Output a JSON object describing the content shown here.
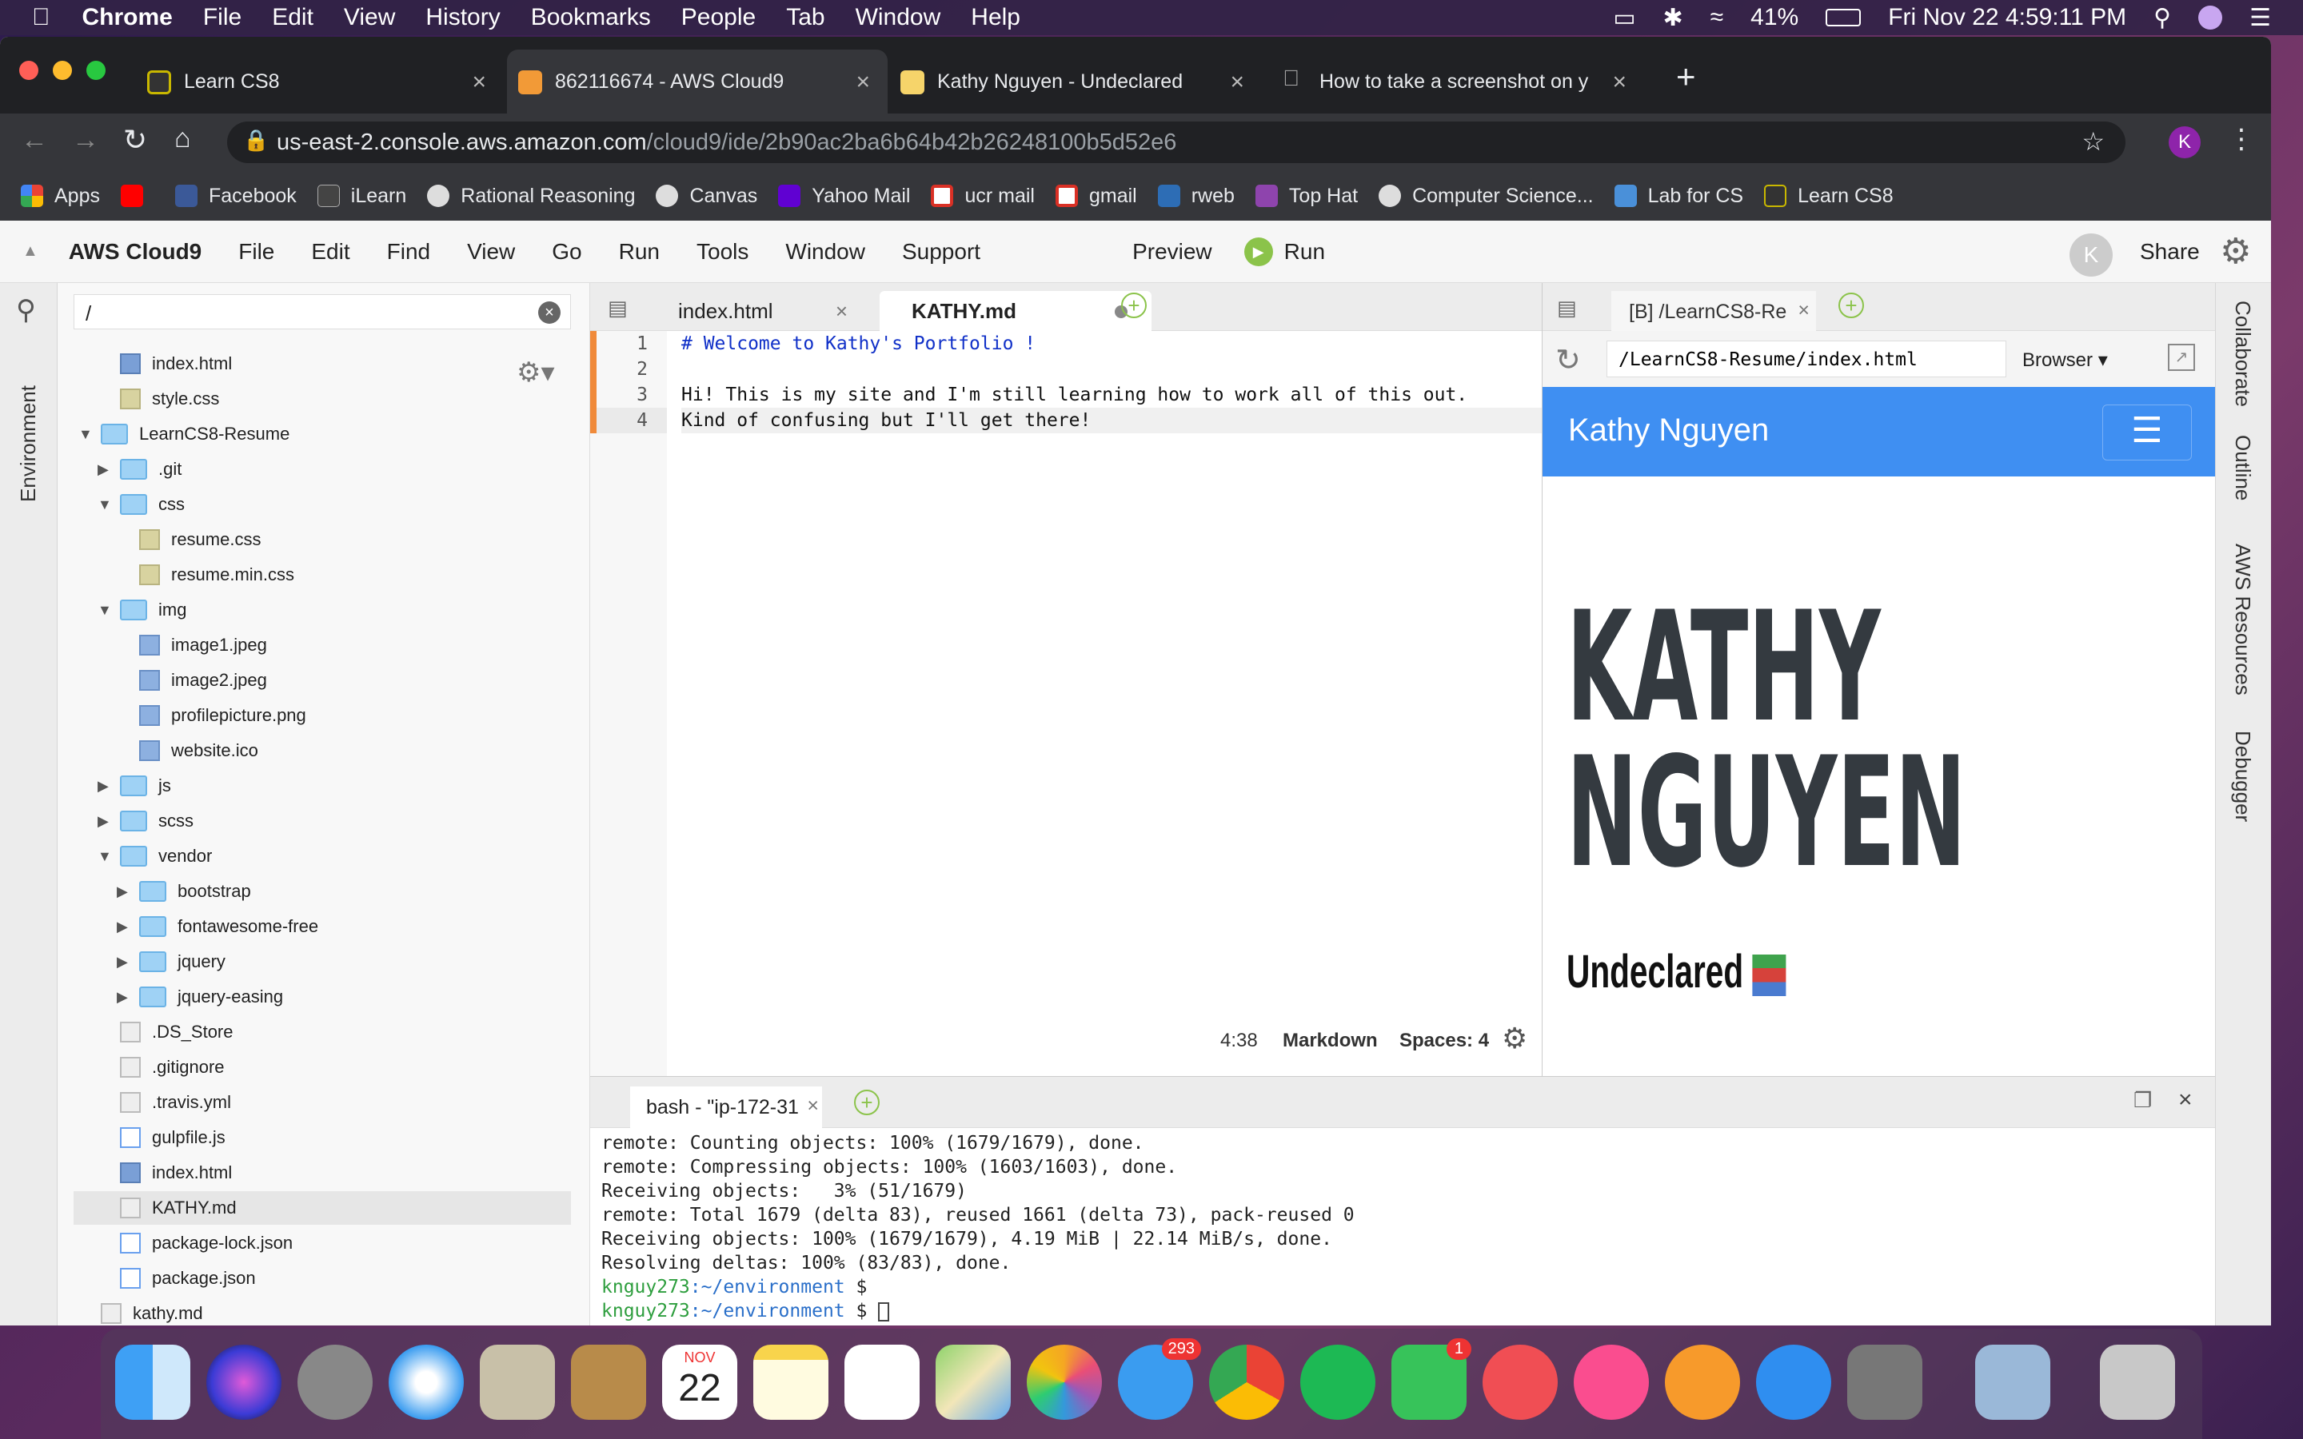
{
  "menubar": {
    "app": "Chrome",
    "items": [
      "File",
      "Edit",
      "View",
      "History",
      "Bookmarks",
      "People",
      "Tab",
      "Window",
      "Help"
    ],
    "battery": "41%",
    "clock": "Fri Nov 22  4:59:11 PM"
  },
  "tabs": [
    {
      "label": "Learn CS8"
    },
    {
      "label": "862116674 - AWS Cloud9"
    },
    {
      "label": "Kathy Nguyen - Undeclared"
    },
    {
      "label": "How to take a screenshot on y"
    }
  ],
  "omnibox": {
    "host": "us-east-2.console.aws.amazon.com",
    "path": "/cloud9/ide/2b90ac2ba6b64b42b26248100b5d52e6"
  },
  "profile_initial": "K",
  "bookmarks": [
    "Apps",
    "Facebook",
    "iLearn",
    "Rational Reasoning",
    "Canvas",
    "Yahoo Mail",
    "ucr mail",
    "gmail",
    "rweb",
    "Top Hat",
    "Computer Science...",
    "Lab for CS",
    "Learn CS8"
  ],
  "c9": {
    "brand": "AWS Cloud9",
    "menu": [
      "File",
      "Edit",
      "Find",
      "View",
      "Go",
      "Run",
      "Tools",
      "Window",
      "Support"
    ],
    "preview": "Preview",
    "run": "Run",
    "user_initial": "K",
    "share": "Share",
    "search_value": "/",
    "env_label": "Environment"
  },
  "tree": [
    {
      "name": "index.html",
      "indent": 2,
      "type": "html"
    },
    {
      "name": "style.css",
      "indent": 2,
      "type": "css"
    },
    {
      "name": "LearnCS8-Resume",
      "indent": 1,
      "type": "folder",
      "open": true
    },
    {
      "name": ".git",
      "indent": 2,
      "type": "folder",
      "open": false
    },
    {
      "name": "css",
      "indent": 2,
      "type": "folder",
      "open": true
    },
    {
      "name": "resume.css",
      "indent": 3,
      "type": "css"
    },
    {
      "name": "resume.min.css",
      "indent": 3,
      "type": "css"
    },
    {
      "name": "img",
      "indent": 2,
      "type": "folder",
      "open": true
    },
    {
      "name": "image1.jpeg",
      "indent": 3,
      "type": "img"
    },
    {
      "name": "image2.jpeg",
      "indent": 3,
      "type": "img"
    },
    {
      "name": "profilepicture.png",
      "indent": 3,
      "type": "img"
    },
    {
      "name": "website.ico",
      "indent": 3,
      "type": "img"
    },
    {
      "name": "js",
      "indent": 2,
      "type": "folder",
      "open": false
    },
    {
      "name": "scss",
      "indent": 2,
      "type": "folder",
      "open": false
    },
    {
      "name": "vendor",
      "indent": 2,
      "type": "folder",
      "open": true
    },
    {
      "name": "bootstrap",
      "indent": 3,
      "type": "folder",
      "open": false
    },
    {
      "name": "fontawesome-free",
      "indent": 3,
      "type": "folder",
      "open": false
    },
    {
      "name": "jquery",
      "indent": 3,
      "type": "folder",
      "open": false
    },
    {
      "name": "jquery-easing",
      "indent": 3,
      "type": "folder",
      "open": false
    },
    {
      "name": ".DS_Store",
      "indent": 2,
      "type": "file"
    },
    {
      "name": ".gitignore",
      "indent": 2,
      "type": "file"
    },
    {
      "name": ".travis.yml",
      "indent": 2,
      "type": "file"
    },
    {
      "name": "gulpfile.js",
      "indent": 2,
      "type": "js"
    },
    {
      "name": "index.html",
      "indent": 2,
      "type": "html"
    },
    {
      "name": "KATHY.md",
      "indent": 2,
      "type": "file",
      "selected": true
    },
    {
      "name": "package-lock.json",
      "indent": 2,
      "type": "js"
    },
    {
      "name": "package.json",
      "indent": 2,
      "type": "js"
    },
    {
      "name": "kathy.md",
      "indent": 1,
      "type": "file"
    }
  ],
  "editor": {
    "tabs": [
      {
        "label": "index.html"
      },
      {
        "label": "KATHY.md"
      }
    ],
    "lines": [
      "# Welcome to Kathy's Portfolio !",
      "",
      "Hi! This is my site and I'm still learning how to work all of this out.",
      "Kind of confusing but I'll get there!"
    ],
    "line_numbers": [
      "1",
      "2",
      "3",
      "4"
    ],
    "status": {
      "pos": "4:38",
      "mode": "Markdown",
      "spaces": "Spaces: 4"
    }
  },
  "preview": {
    "tab": "[B] /LearnCS8-Re",
    "address": "/LearnCS8-Resume/index.html",
    "browser": "Browser",
    "nav_title": "Kathy Nguyen",
    "heading_1": "KATHY",
    "heading_2": "NGUYEN",
    "subheading": "Undeclared"
  },
  "right_panels": [
    "Collaborate",
    "Outline",
    "AWS Resources",
    "Debugger"
  ],
  "terminal": {
    "tab": "bash - \"ip-172-31",
    "lines": [
      "remote: Counting objects: 100% (1679/1679), done.",
      "remote: Compressing objects: 100% (1603/1603), done.",
      "Receiving objects:   3% (51/1679)",
      "remote: Total 1679 (delta 83), reused 1661 (delta 73), pack-reused 0",
      "Receiving objects: 100% (1679/1679), 4.19 MiB | 22.14 MiB/s, done.",
      "Resolving deltas: 100% (83/83), done."
    ],
    "prompt_user": "knguy273",
    "prompt_path": ":~/environment",
    "prompt_sym": " $"
  },
  "dock": {
    "messages_badge": "293",
    "facetime_badge": "1",
    "calendar_month": "NOV",
    "calendar_day": "22"
  }
}
